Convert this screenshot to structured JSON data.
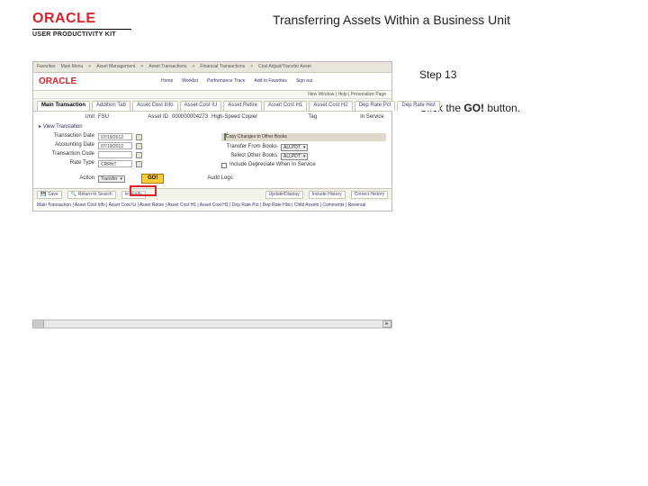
{
  "header": {
    "brand": "ORACLE",
    "brand_sub": "USER PRODUCTIVITY KIT",
    "page_title": "Transferring Assets Within a Business Unit"
  },
  "instruction": {
    "step_label": "Step 13",
    "line_pre": "Click the ",
    "button_name": "GO!",
    "line_post": " button."
  },
  "screenshot": {
    "breadcrumb": [
      "Favorites",
      "Main Menu",
      "Asset Management",
      "Asset Transactions",
      "Financial Transactions",
      "Cost Adjust/Transfer Asset"
    ],
    "oracle": "ORACLE",
    "nav": [
      "Home",
      "Worklist",
      "Performance Trace",
      "Add to Favorites",
      "Sign out"
    ],
    "subhead": "New Window | Help | Personalize Page",
    "tabs": [
      "Main Transaction",
      "Addition Tab",
      "Asset Cost Info",
      "Asset Cost IU",
      "Asset Retire",
      "Asset Cost H1",
      "Asset Cost H2",
      "Dep Rate Pct",
      "Dep Rate Hist"
    ],
    "row_unit_label": "Unit",
    "row_unit_val": "FSU",
    "row_asset_label": "Asset ID",
    "row_asset_val": "000000004273",
    "row_asset_desc": "High-Speed Copier",
    "row_tag_label": "Tag",
    "row_status_label": "In Service",
    "collapsed_link": "View Translation",
    "copy_header": "Copy Changes to Other Books",
    "left_fields": [
      {
        "label": "Transaction Date",
        "value": "07/19/2012"
      },
      {
        "label": "Accounting Date",
        "value": "07/19/2012"
      },
      {
        "label": "Transaction Code",
        "value": ""
      },
      {
        "label": "Rate Type",
        "value": "CRRNT"
      }
    ],
    "right_fields": [
      {
        "label": "Transfer From Books",
        "value": "ALLPDT"
      },
      {
        "label": "Select Other Books",
        "value": "ALLPDT"
      },
      {
        "label": "Include Depreciate When In Service",
        "value": ""
      }
    ],
    "action_label": "Action",
    "action_value": "Transfer",
    "go_label": "GO!",
    "audit_label": "Audit Logs",
    "foot_buttons": [
      "Save",
      "Return to Search",
      "Notify"
    ],
    "foot_buttons_right": [
      "Update/Display",
      "Include History",
      "Correct History"
    ],
    "foot_links": "Main Transaction | Asset Cost Info | Asset Cost IU | Asset Retire | Asset Cost H1 | Asset Cost H2 | Dep Rate Pct | Dep Rate Hist | Child Assets | Comments | Reversal"
  }
}
